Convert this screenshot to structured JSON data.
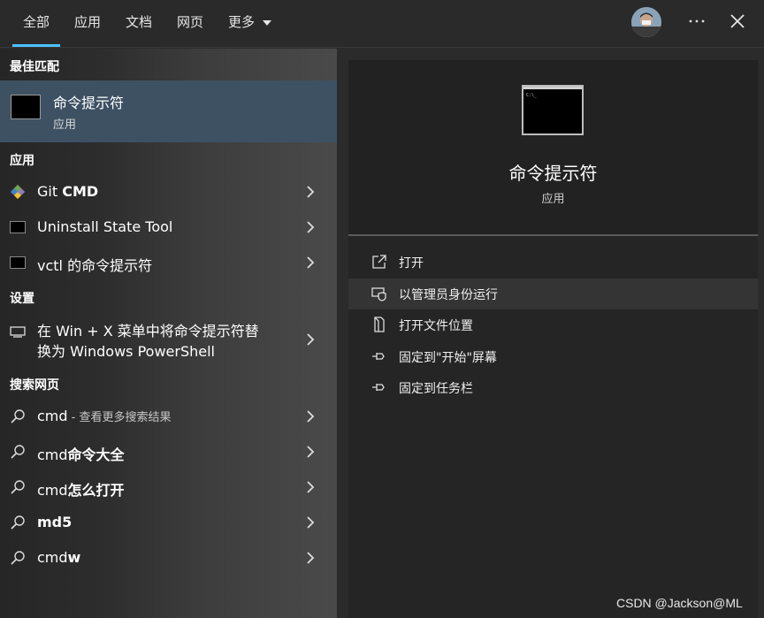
{
  "tabs": [
    {
      "label": "全部",
      "active": true
    },
    {
      "label": "应用"
    },
    {
      "label": "文档"
    },
    {
      "label": "网页"
    },
    {
      "label": "更多"
    }
  ],
  "topbar": {
    "more_icon": "ellipsis-icon",
    "close_icon": "close-icon"
  },
  "left": {
    "best_match_header": "最佳匹配",
    "best_match": {
      "title": "命令提示符",
      "subtitle": "应用"
    },
    "apps_header": "应用",
    "apps": [
      {
        "label_prefix": "Git ",
        "label_bold": "CMD",
        "icon": "git-icon"
      },
      {
        "label_prefix": "Uninstall State Tool",
        "label_bold": "",
        "icon": "terminal-icon"
      },
      {
        "label_prefix": "vctl 的命令提示符",
        "label_bold": "",
        "icon": "terminal-icon"
      }
    ],
    "settings_header": "设置",
    "settings": [
      {
        "line1": "在 Win + X 菜单中将命令提示符替",
        "line2": "换为 Windows PowerShell",
        "icon": "monitor-icon"
      }
    ],
    "web_header": "搜索网页",
    "web": [
      {
        "main": "cmd",
        "bold": "",
        "sub": " - 查看更多搜索结果"
      },
      {
        "main": "cmd",
        "bold": "命令大全",
        "sub": ""
      },
      {
        "main": "cmd",
        "bold": "怎么打开",
        "sub": ""
      },
      {
        "main": "",
        "bold": "md5",
        "sub": ""
      },
      {
        "main": "cmd",
        "bold": "w",
        "sub": ""
      }
    ]
  },
  "right": {
    "title": "命令提示符",
    "subtitle": "应用",
    "actions": [
      {
        "label": "打开",
        "icon": "open-icon"
      },
      {
        "label": "以管理员身份运行",
        "icon": "shield-icon"
      },
      {
        "label": "打开文件位置",
        "icon": "file-location-icon"
      },
      {
        "label": "固定到\"开始\"屏幕",
        "icon": "pin-icon"
      },
      {
        "label": "固定到任务栏",
        "icon": "pin-icon"
      }
    ]
  },
  "watermark": "CSDN @Jackson@ML",
  "colors": {
    "accent": "#4cc2ff",
    "selected_bg": "#3d5163"
  }
}
